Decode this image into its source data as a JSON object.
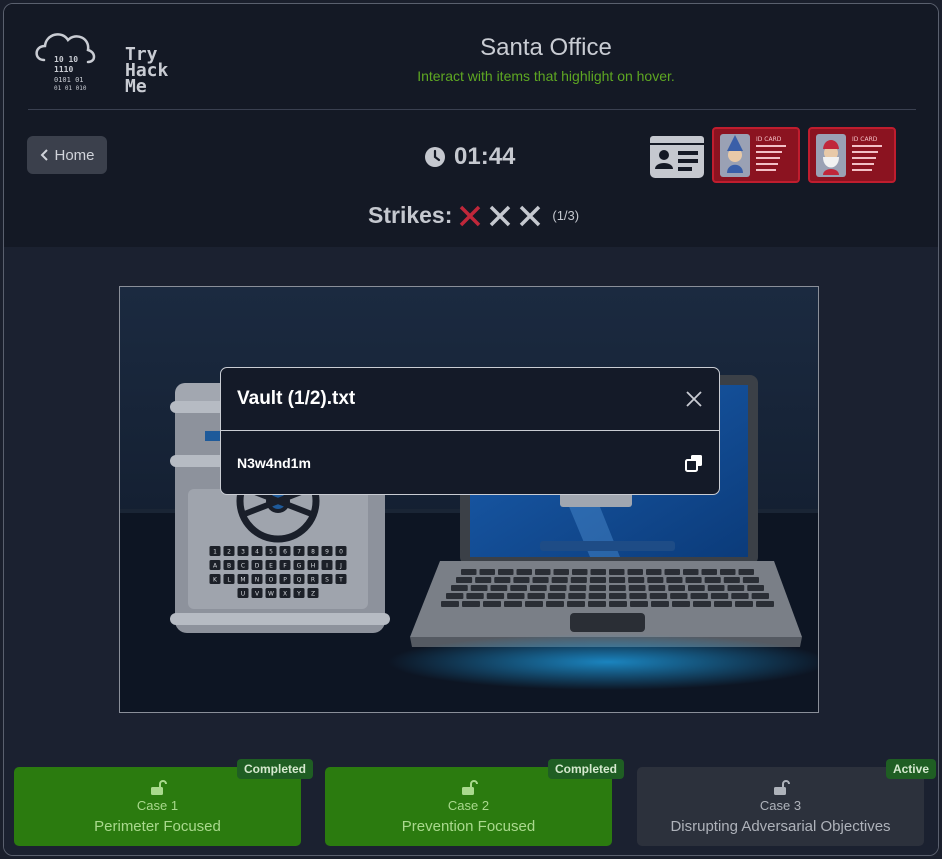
{
  "logo": {
    "lines": [
      "Try",
      "Hack",
      "Me"
    ],
    "binary": [
      "10  10",
      "1110",
      "0101  01",
      "01  010"
    ]
  },
  "header": {
    "title": "Santa Office",
    "subtitle": "Interact with items that highlight on hover."
  },
  "nav": {
    "home_label": "Home"
  },
  "timer": {
    "value": "01:44"
  },
  "strikes": {
    "label": "Strikes:",
    "count": "(1/3)",
    "used": 1,
    "total": 3
  },
  "id_cards": [
    {
      "label": "ID CARD"
    },
    {
      "label": "ID CARD"
    }
  ],
  "scene": {
    "keypad_rows": [
      [
        "1",
        "2",
        "3",
        "4",
        "5",
        "6",
        "7",
        "8",
        "9",
        "0"
      ],
      [
        "A",
        "B",
        "C",
        "D",
        "E",
        "F",
        "G",
        "H",
        "I",
        "J"
      ],
      [
        "K",
        "L",
        "M",
        "N",
        "O",
        "P",
        "Q",
        "R",
        "S",
        "T"
      ],
      [
        "U",
        "V",
        "W",
        "X",
        "Y",
        "Z"
      ]
    ]
  },
  "modal": {
    "title": "Vault (1/2).txt",
    "content": "N3w4nd1m"
  },
  "cases": [
    {
      "number": "Case 1",
      "name": "Perimeter Focused",
      "status": "Completed"
    },
    {
      "number": "Case 2",
      "name": "Prevention Focused",
      "status": "Completed"
    },
    {
      "number": "Case 3",
      "name": "Disrupting Adversarial Objectives",
      "status": "Active"
    }
  ],
  "colors": {
    "accent_green": "#5ea722",
    "case_completed": "#2b7b0f",
    "strike_used": "#c0273a",
    "id_card": "#8b1320"
  }
}
